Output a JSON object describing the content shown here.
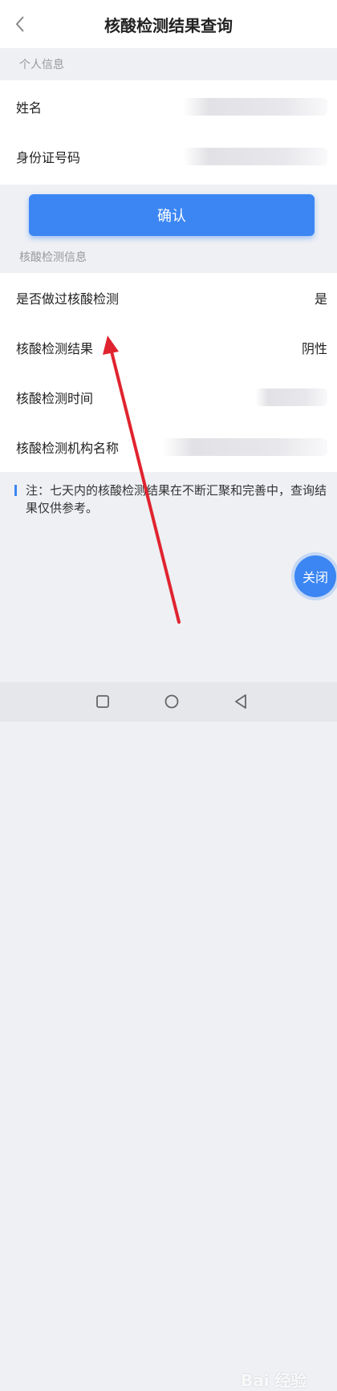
{
  "header": {
    "title": "核酸检测结果查询",
    "back_icon": "chevron-left-icon"
  },
  "personal_section": {
    "label": "个人信息",
    "rows": [
      {
        "label": "姓名",
        "value_hidden": true
      },
      {
        "label": "身份证号码",
        "value_hidden": true
      }
    ]
  },
  "confirm_button": {
    "label": "确认"
  },
  "test_section": {
    "label": "核酸检测信息",
    "rows": [
      {
        "label": "是否做过核酸检测",
        "value": "是"
      },
      {
        "label": "核酸检测结果",
        "value": "阴性"
      },
      {
        "label": "核酸检测时间",
        "value_hidden": true
      },
      {
        "label": "核酸检测机构名称",
        "value_hidden": true
      }
    ]
  },
  "note": {
    "text": "注：七天内的核酸检测结果在不断汇聚和完善中，查询结果仅供参考。"
  },
  "close_button": {
    "label": "关闭"
  },
  "navbar": {
    "items": [
      "square-icon",
      "circle-icon",
      "triangle-back-icon"
    ]
  },
  "watermark": {
    "text": "Bai 经验"
  },
  "colors": {
    "accent": "#3b86f3",
    "annotation": "#e0242f",
    "background": "#eef0f4"
  }
}
